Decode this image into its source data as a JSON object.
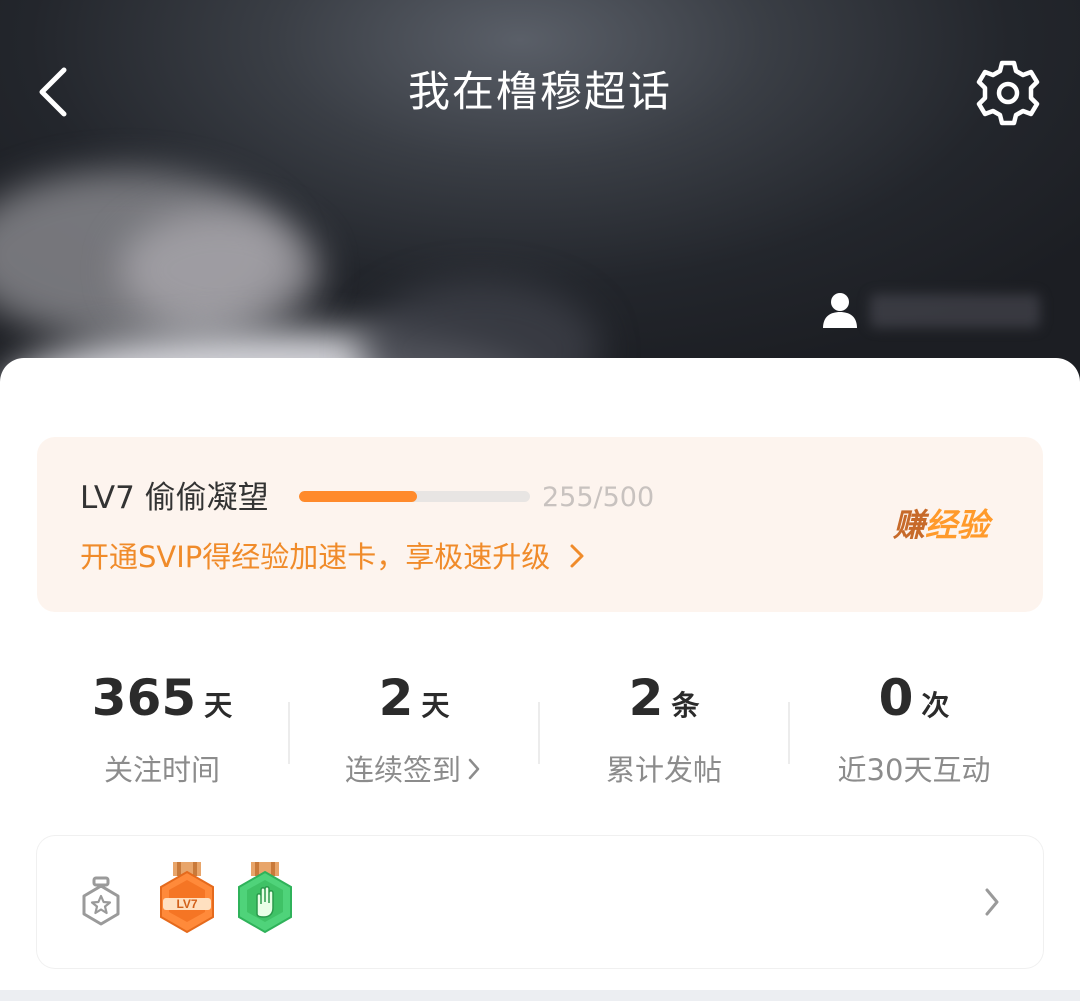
{
  "header": {
    "title": "我在橹穆超话"
  },
  "level": {
    "name": "LV7 偷偷凝望",
    "progress_fraction": 0.51,
    "progress_text": "255/500",
    "promo": "开通SVIP得经验加速卡，享极速升级",
    "earn_part1": "赚",
    "earn_part2": "经验"
  },
  "stats": [
    {
      "value": "365",
      "unit": "天",
      "label": "关注时间"
    },
    {
      "value": "2",
      "unit": "天",
      "label": "连续签到"
    },
    {
      "value": "2",
      "unit": "条",
      "label": "累计发帖"
    },
    {
      "value": "0",
      "unit": "次",
      "label": "近30天互动"
    }
  ],
  "badges": {
    "lv_badge_text": "LV7"
  },
  "colors": {
    "accent_orange": "#ff8a2b",
    "promo_text": "#f08b2a",
    "badge_green": "#3fc266"
  },
  "icons": [
    "back-arrow-icon",
    "gear-icon",
    "user-icon",
    "badge-wall-icon",
    "chevron-right-icon"
  ]
}
